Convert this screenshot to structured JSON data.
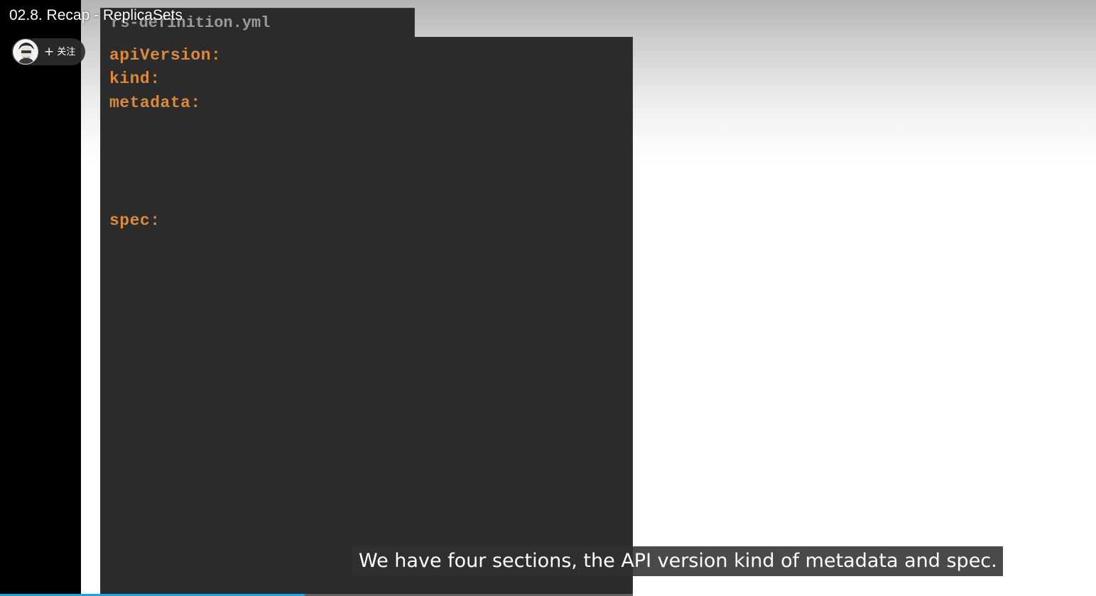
{
  "video": {
    "title": "02.8. Recap - ReplicaSets",
    "follow_label": "关注",
    "subtitle": "We have four sections, the API version kind of metadata and spec.",
    "progress_fraction": 0.278
  },
  "slide": {
    "file_name": "rs-definition.yml",
    "code_lines": [
      "apiVersion:",
      "kind:",
      "metadata:",
      "spec:"
    ]
  },
  "colors": {
    "code_keyword": "#d98a3e",
    "editor_bg": "#2b2b2b",
    "progress": "#1aa3e6"
  },
  "icons": {
    "follow": "plus-icon",
    "avatar": "avatar-icon"
  }
}
